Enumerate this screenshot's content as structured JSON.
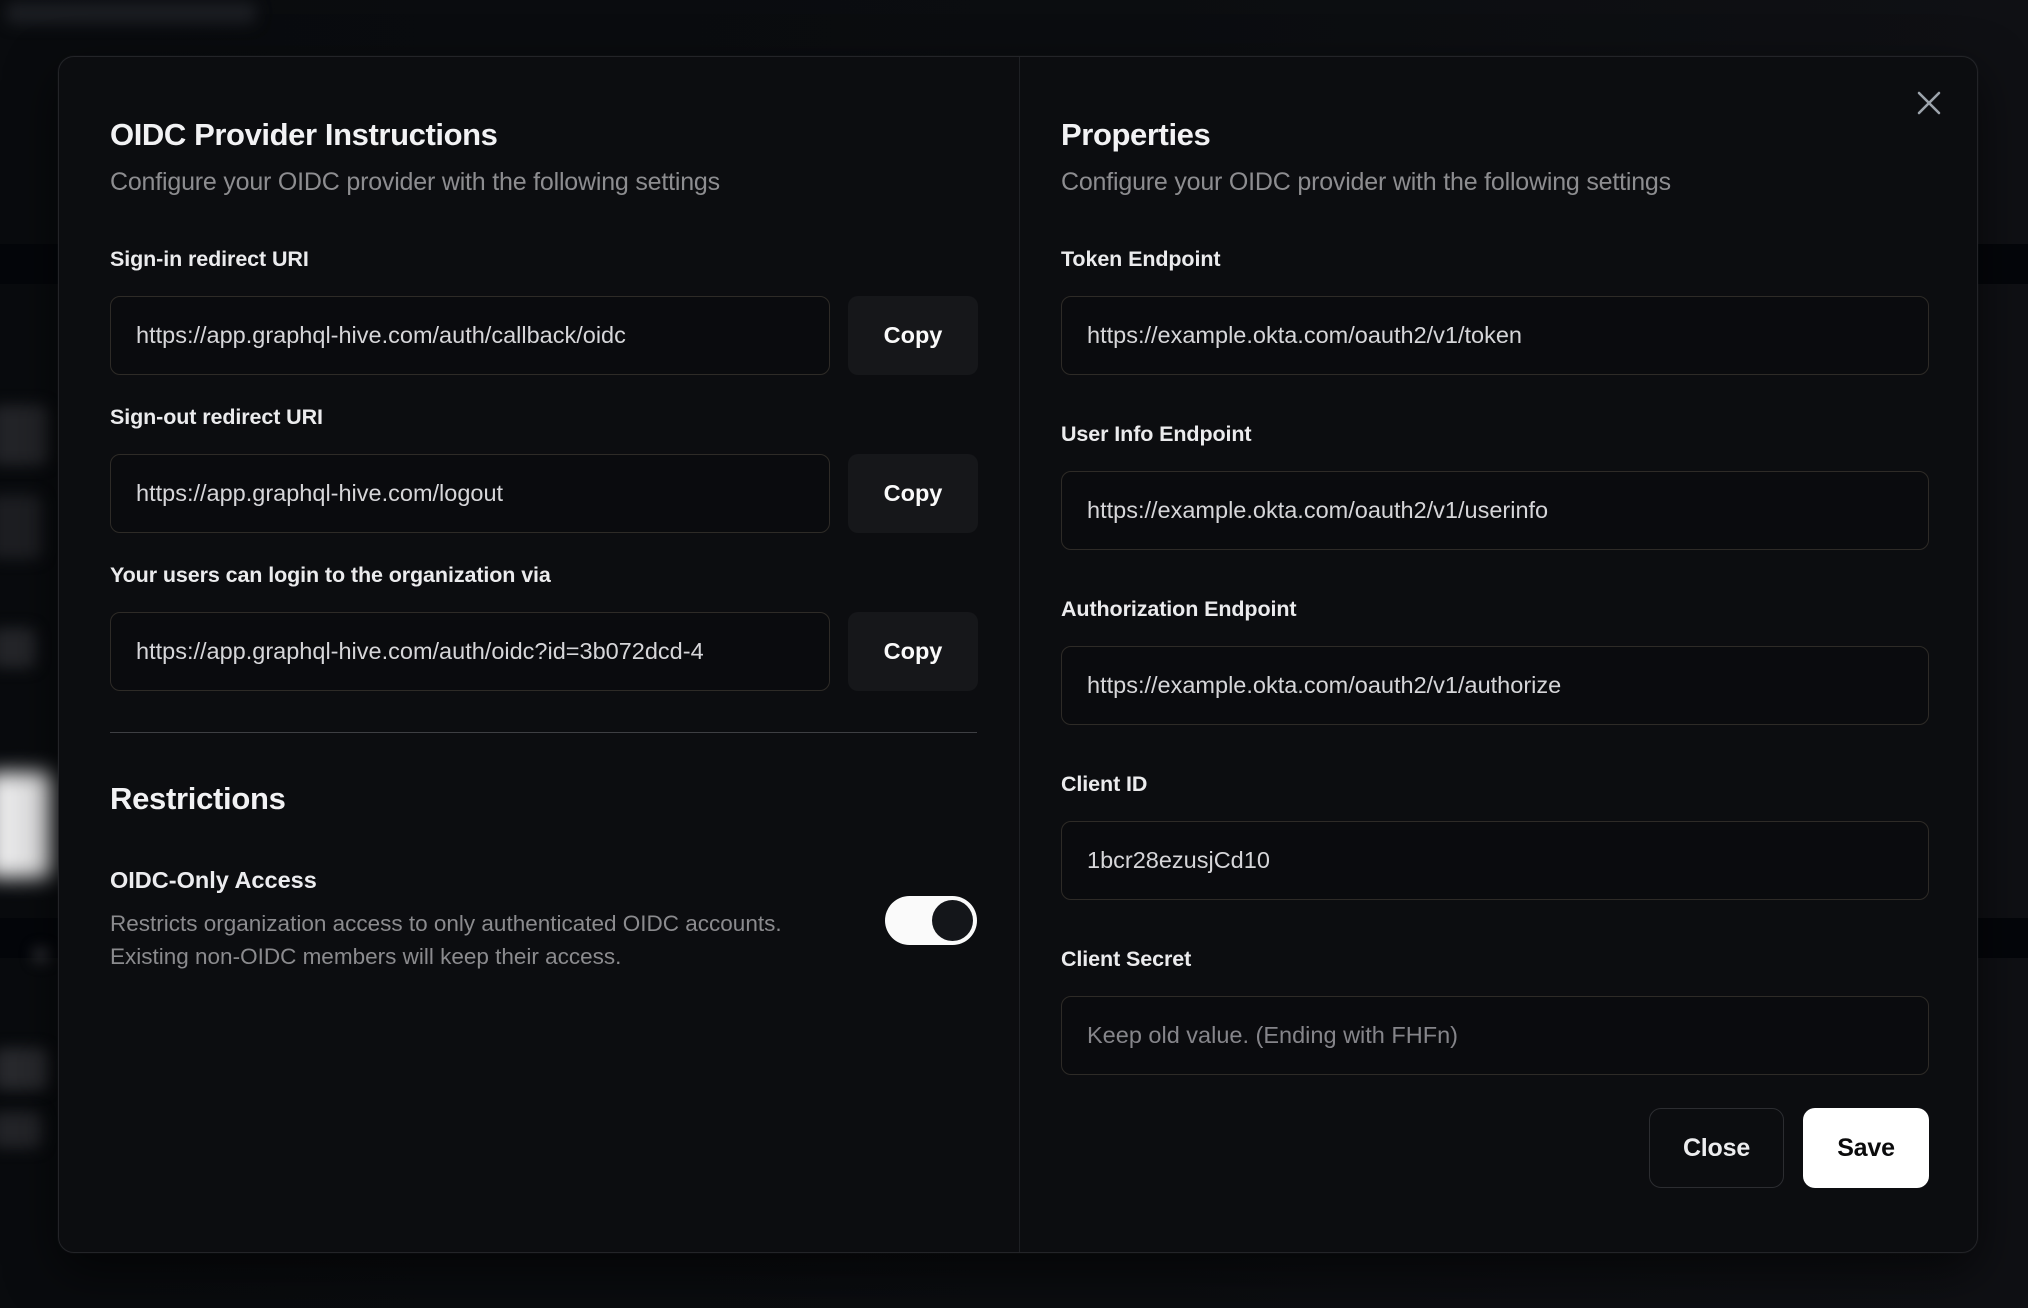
{
  "modal": {
    "left": {
      "title": "OIDC Provider Instructions",
      "subtitle": "Configure your OIDC provider with the following settings",
      "fields": [
        {
          "label": "Sign-in redirect URI",
          "value": "https://app.graphql-hive.com/auth/callback/oidc",
          "copy_label": "Copy"
        },
        {
          "label": "Sign-out redirect URI",
          "value": "https://app.graphql-hive.com/logout",
          "copy_label": "Copy"
        },
        {
          "label": "Your users can login to the organization via",
          "value": "https://app.graphql-hive.com/auth/oidc?id=3b072dcd-4",
          "copy_label": "Copy"
        }
      ],
      "restrictions": {
        "title": "Restrictions",
        "toggle_label": "OIDC-Only Access",
        "toggle_description_line1": "Restricts organization access to only authenticated OIDC accounts.",
        "toggle_description_line2": "Existing non-OIDC members will keep their access.",
        "toggle_state": "on"
      }
    },
    "right": {
      "title": "Properties",
      "subtitle": "Configure your OIDC provider with the following settings",
      "fields": [
        {
          "label": "Token Endpoint",
          "value": "https://example.okta.com/oauth2/v1/token"
        },
        {
          "label": "User Info Endpoint",
          "value": "https://example.okta.com/oauth2/v1/userinfo"
        },
        {
          "label": "Authorization Endpoint",
          "value": "https://example.okta.com/oauth2/v1/authorize"
        },
        {
          "label": "Client ID",
          "value": "1bcr28ezusjCd10"
        },
        {
          "label": "Client Secret",
          "value": "",
          "placeholder": "Keep old value. (Ending with FHFn)"
        }
      ],
      "buttons": {
        "close": "Close",
        "save": "Save"
      }
    },
    "colors": {
      "modal_background": "#0c0d10",
      "save_button_background": "#ffffff",
      "toggle_on_track": "#fafafa",
      "toggle_thumb": "#14161a"
    }
  }
}
